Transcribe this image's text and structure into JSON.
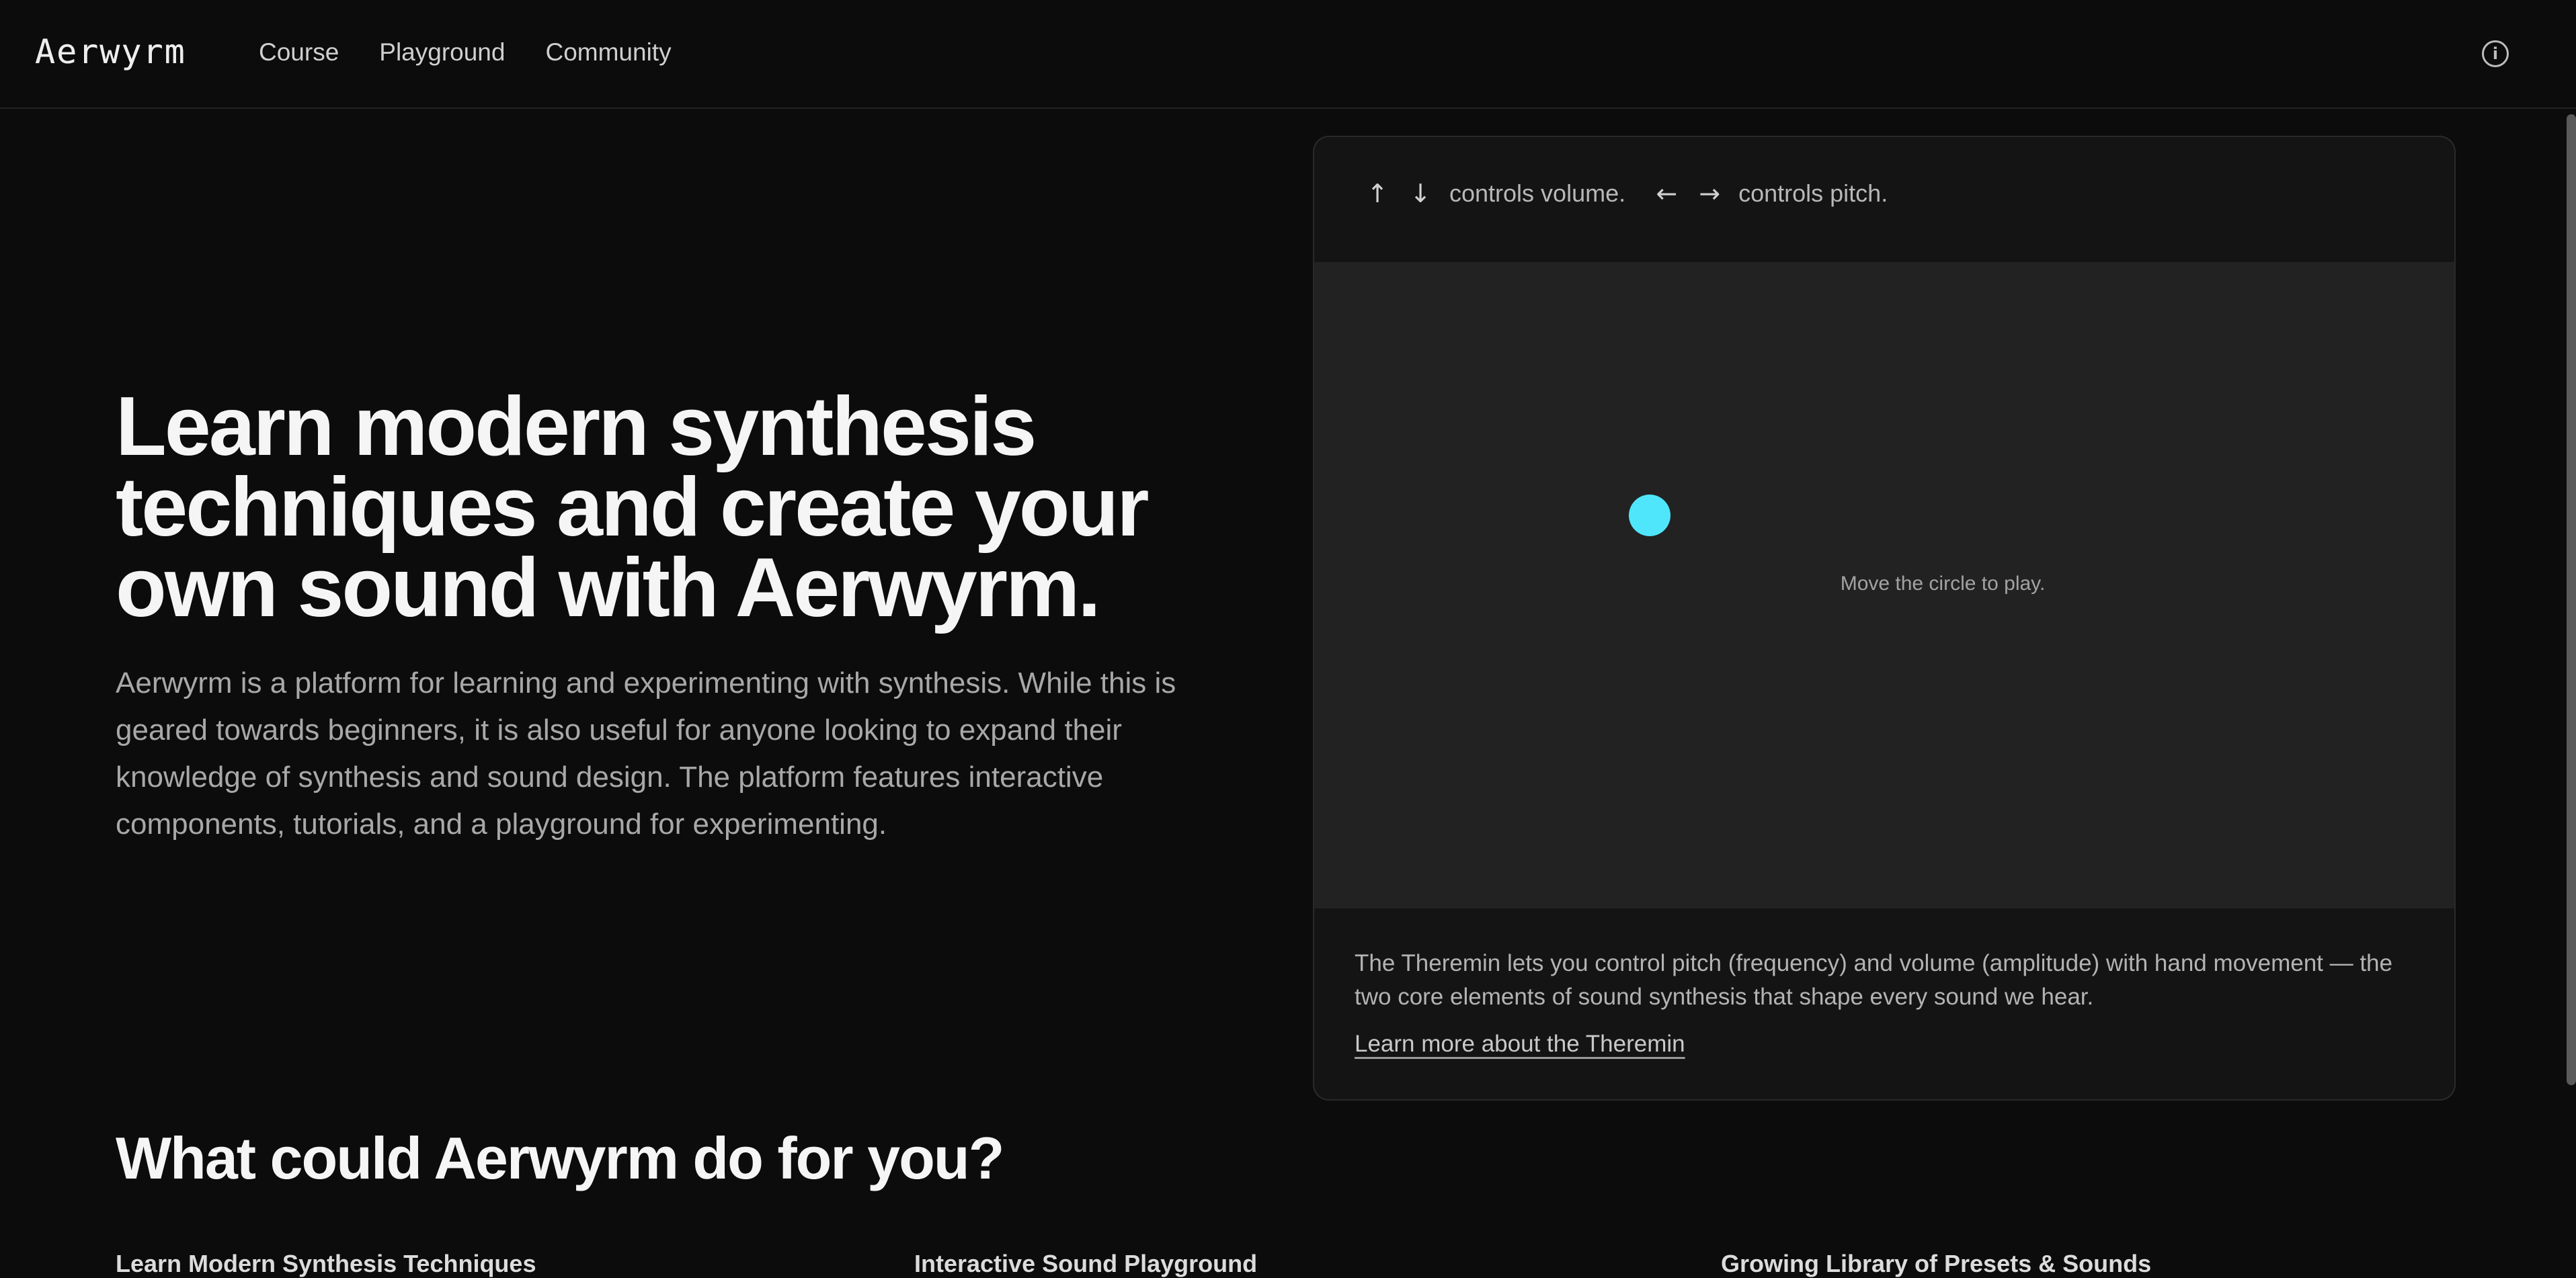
{
  "header": {
    "logo": "Aerwyrm",
    "nav": [
      "Course",
      "Playground",
      "Community"
    ],
    "info_icon": "info-icon"
  },
  "hero": {
    "title": "Learn modern synthesis techniques and create your own sound with Aerwyrm.",
    "description": "Aerwyrm is a platform for learning and experimenting with synthesis. While this is geared towards beginners, it is also useful for anyone looking to expand their knowledge of synthesis and sound design. The platform features interactive components, tutorials, and a playground for experimenting."
  },
  "theremin": {
    "volume_text": "controls volume.",
    "pitch_text": "controls pitch.",
    "hint": "Move the circle to play.",
    "description": "The Theremin lets you control pitch (frequency) and volume (amplitude) with hand movement — the two core elements of sound synthesis that shape every sound we hear.",
    "link": "Learn more about the Theremin",
    "knob_color": "#4fe5fb"
  },
  "section": {
    "title": "What could Aerwyrm do for you?",
    "peek": [
      "Learn Modern Synthesis Techniques",
      "Interactive Sound Playground",
      "Growing Library of Presets & Sounds"
    ]
  }
}
